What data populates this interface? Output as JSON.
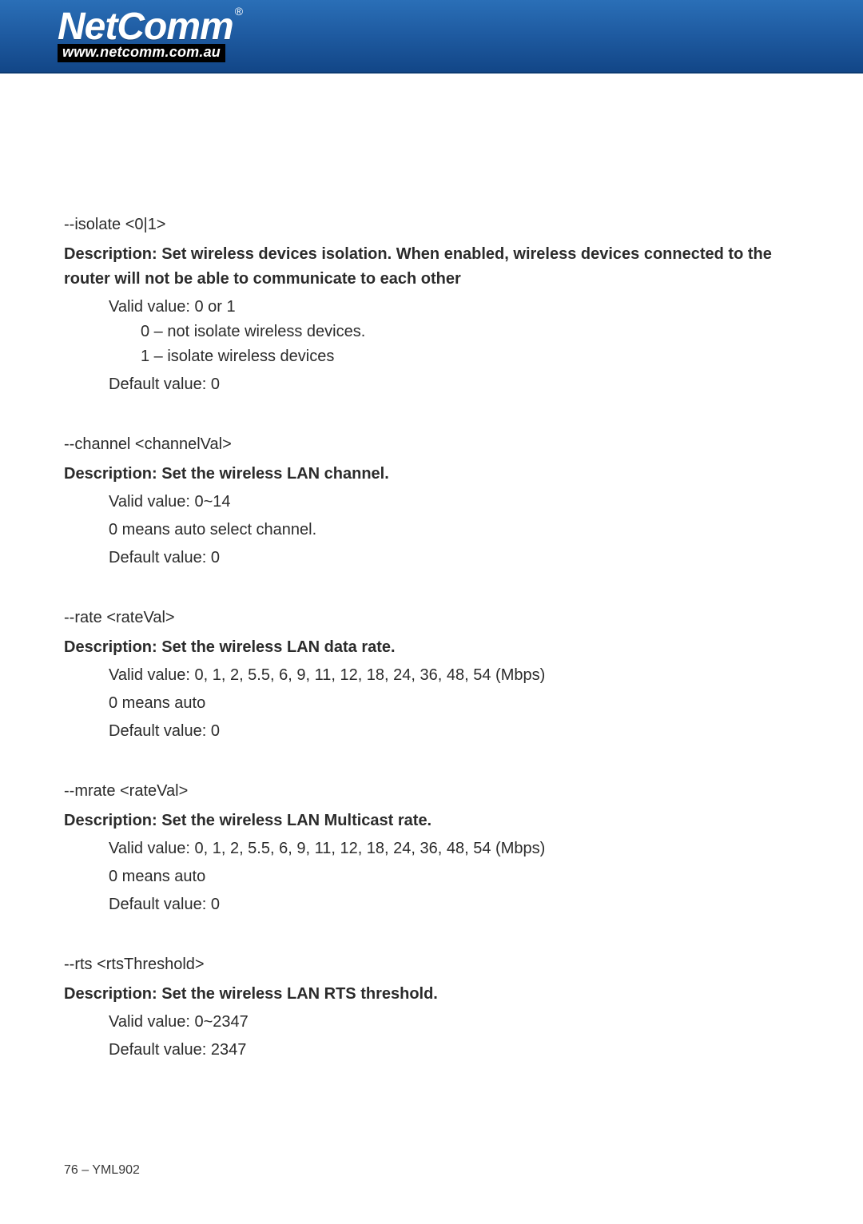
{
  "header": {
    "brand": "NetComm",
    "registered": "®",
    "url": "www.netcomm.com.au"
  },
  "sections": [
    {
      "cmd": "--isolate <0|1>",
      "desc": "Description: Set wireless devices isolation. When enabled, wireless devices connected to the router will not be able to communicate to each other",
      "lines1": [
        "Valid value: 0 or 1"
      ],
      "lines2": [
        "0 – not isolate wireless devices.",
        "1 – isolate wireless devices"
      ],
      "lines1b": [
        "Default value: 0"
      ]
    },
    {
      "cmd": "--channel <channelVal>",
      "desc": "Description: Set the wireless LAN channel.",
      "lines1": [
        "Valid value: 0~14",
        "0 means auto select channel.",
        "Default value: 0"
      ],
      "lines2": [],
      "lines1b": []
    },
    {
      "cmd": "--rate <rateVal>",
      "desc": "Description: Set the wireless LAN data rate.",
      "lines1": [
        "Valid value: 0, 1, 2, 5.5, 6, 9, 11, 12, 18, 24, 36, 48, 54 (Mbps)",
        "0 means auto",
        "Default value: 0"
      ],
      "lines2": [],
      "lines1b": []
    },
    {
      "cmd": "--mrate <rateVal>",
      "desc": "Description: Set the wireless LAN Multicast rate.",
      "lines1": [
        "Valid value: 0, 1, 2, 5.5, 6, 9, 11, 12, 18, 24, 36, 48, 54 (Mbps)",
        "0 means auto",
        "Default value: 0"
      ],
      "lines2": [],
      "lines1b": []
    },
    {
      "cmd": "--rts <rtsThreshold>",
      "desc": "Description: Set the wireless LAN RTS threshold.",
      "lines1": [
        "Valid value: 0~2347",
        "Default value: 2347"
      ],
      "lines2": [],
      "lines1b": []
    }
  ],
  "footer": "76 – YML902"
}
